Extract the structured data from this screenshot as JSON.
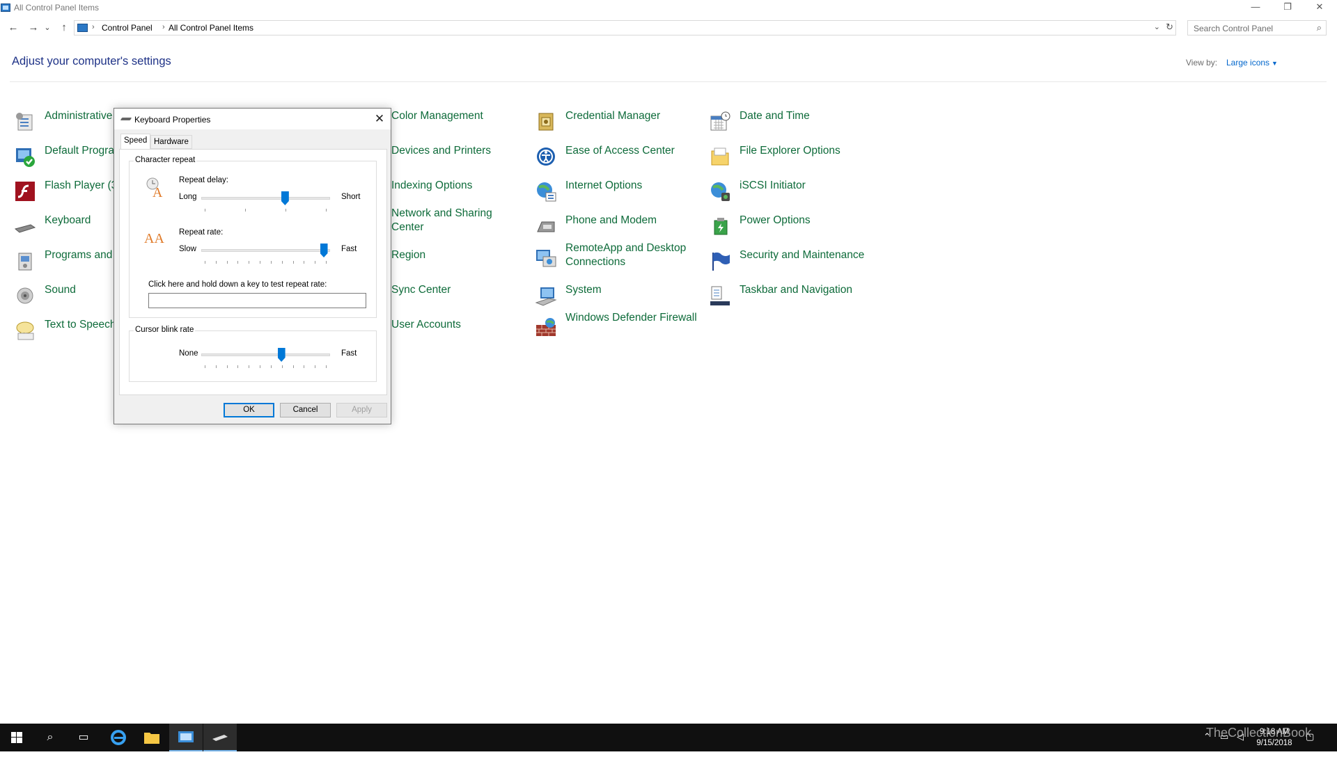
{
  "window": {
    "title": "All Control Panel Items",
    "minimize": "—",
    "restore": "❐",
    "close": "✕"
  },
  "nav": {
    "back": "←",
    "forward": "→",
    "recent": "⌄",
    "up": "↑",
    "breadcrumb": [
      "Control Panel",
      "All Control Panel Items"
    ],
    "breadcrumb_sep": "›",
    "search_placeholder": "Search Control Panel"
  },
  "header": {
    "title": "Adjust your computer's settings",
    "view_by_label": "View by:",
    "view_by_value": "Large icons"
  },
  "items": {
    "col1": [
      {
        "label": "Administrative",
        "icon": "admin-tools-icon"
      },
      {
        "label": "Default Progra",
        "icon": "default-programs-icon"
      },
      {
        "label": "Flash Player (3",
        "icon": "flash-player-icon"
      },
      {
        "label": "Keyboard",
        "icon": "keyboard-icon"
      },
      {
        "label": "Programs and",
        "icon": "programs-icon"
      },
      {
        "label": "Sound",
        "icon": "sound-icon"
      },
      {
        "label": "Text to Speech",
        "icon": "text-to-speech-icon"
      }
    ],
    "col2": [
      {
        "label": "Color Management",
        "icon": "color-management-icon"
      },
      {
        "label": "Devices and Printers",
        "icon": "devices-printers-icon"
      },
      {
        "label": "Indexing Options",
        "icon": "indexing-icon"
      },
      {
        "label": "Network and Sharing Center",
        "icon": "network-icon"
      },
      {
        "label": "Region",
        "icon": "region-icon"
      },
      {
        "label": "Sync Center",
        "icon": "sync-icon"
      },
      {
        "label": "User Accounts",
        "icon": "user-accounts-icon"
      }
    ],
    "col3": [
      {
        "label": "Credential Manager",
        "icon": "credential-manager-icon"
      },
      {
        "label": "Ease of Access Center",
        "icon": "ease-of-access-icon"
      },
      {
        "label": "Internet Options",
        "icon": "internet-options-icon"
      },
      {
        "label": "Phone and Modem",
        "icon": "phone-modem-icon"
      },
      {
        "label": "RemoteApp and Desktop Connections",
        "icon": "remoteapp-icon"
      },
      {
        "label": "System",
        "icon": "system-icon"
      },
      {
        "label": "Windows Defender Firewall",
        "icon": "firewall-icon"
      }
    ],
    "col4": [
      {
        "label": "Date and Time",
        "icon": "date-time-icon"
      },
      {
        "label": "File Explorer Options",
        "icon": "file-explorer-options-icon"
      },
      {
        "label": "iSCSI Initiator",
        "icon": "iscsi-icon"
      },
      {
        "label": "Power Options",
        "icon": "power-options-icon"
      },
      {
        "label": "Security and Maintenance",
        "icon": "security-flag-icon"
      },
      {
        "label": "Taskbar and Navigation",
        "icon": "taskbar-icon"
      }
    ]
  },
  "dialog": {
    "title": "Keyboard Properties",
    "close": "✕",
    "tabs": [
      "Speed",
      "Hardware"
    ],
    "char_repeat": {
      "group_title": "Character repeat",
      "delay_label": "Repeat delay:",
      "delay_left": "Long",
      "delay_right": "Short",
      "delay_value": 0.66,
      "rate_label": "Repeat rate:",
      "rate_left": "Slow",
      "rate_right": "Fast",
      "rate_value": 0.98,
      "test_label": "Click here and hold down a key to test repeat rate:",
      "test_value": ""
    },
    "cursor_blink": {
      "group_title": "Cursor blink rate",
      "left": "None",
      "right": "Fast",
      "value": 0.63
    },
    "buttons": {
      "ok": "OK",
      "cancel": "Cancel",
      "apply": "Apply"
    }
  },
  "taskbar": {
    "time": "9:18 AM",
    "date": "9/15/2018",
    "watermark": "TheCollectionBook"
  }
}
